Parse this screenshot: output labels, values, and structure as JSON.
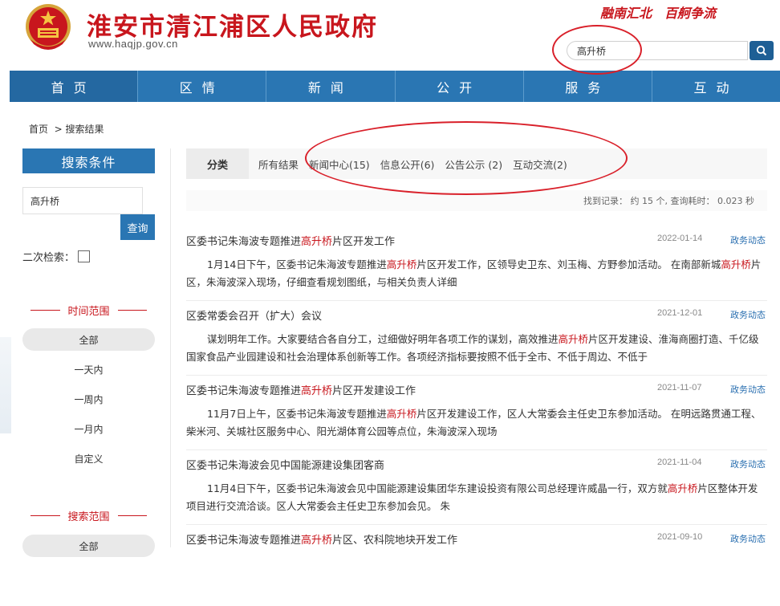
{
  "header": {
    "site_title": "淮安市清江浦区人民政府",
    "site_url": "www.haqjp.gov.cn",
    "slogan": [
      "融南汇北",
      "百舸争流"
    ]
  },
  "search": {
    "value": "高升桥"
  },
  "nav": [
    "首页",
    "区情",
    "新闻",
    "公开",
    "服务",
    "互动"
  ],
  "breadcrumb": {
    "home": "首页",
    "current": "> 搜索结果"
  },
  "left": {
    "title": "搜索条件",
    "input_value": "高升桥",
    "query_btn": "查询",
    "second_search": "二次检索：",
    "time_range": {
      "heading": "时间范围",
      "options": [
        "全部",
        "一天内",
        "一周内",
        "一月内",
        "自定义"
      ],
      "active": "全部"
    },
    "search_range": {
      "heading": "搜索范围",
      "options": [
        "全部"
      ]
    }
  },
  "tabs": {
    "category": "分类",
    "items": [
      "所有结果",
      "新闻中心(15)",
      "信息公开(6)",
      "公告公示 (2)",
      "互动交流(2)"
    ]
  },
  "stats": "找到记录： 约 15 个, 查询耗时： 0.023 秒",
  "keyword": "高升桥",
  "results": [
    {
      "title_parts": [
        "区委书记朱海波专题推进",
        "高升桥",
        "片区开发工作"
      ],
      "date": "2022-01-14",
      "category": "政务动态",
      "summary_parts": [
        "1月14日下午，区委书记朱海波专题推进",
        "高升桥",
        "片区开发工作，区领导史卫东、刘玉梅、方野参加活动。 在南部新城",
        "高升桥",
        "片区，朱海波深入现场，仔细查看规划图纸，与相关负责人详细"
      ]
    },
    {
      "title_parts": [
        "区委常委会召开（扩大）会议"
      ],
      "date": "2021-12-01",
      "category": "政务动态",
      "summary_parts": [
        "谋划明年工作。大家要结合各自分工，过细做好明年各项工作的谋划，高效推进",
        "高升桥",
        "片区开发建设、淮海商圈打造、千亿级国家食品产业园建设和社会治理体系创新等工作。各项经济指标要按照不低于全市、不低于周边、不低于"
      ]
    },
    {
      "title_parts": [
        "区委书记朱海波专题推进",
        "高升桥",
        "片区开发建设工作"
      ],
      "date": "2021-11-07",
      "category": "政务动态",
      "summary_parts": [
        "11月7日上午，区委书记朱海波专题推进",
        "高升桥",
        "片区开发建设工作，区人大常委会主任史卫东参加活动。 在明远路贯通工程、柴米河、关城社区服务中心、阳光湖体育公园等点位，朱海波深入现场"
      ]
    },
    {
      "title_parts": [
        "区委书记朱海波会见中国能源建设集团客商"
      ],
      "date": "2021-11-04",
      "category": "政务动态",
      "summary_parts": [
        "11月4日下午，区委书记朱海波会见中国能源建设集团华东建设投资有限公司总经理许威晶一行，双方就",
        "高升桥",
        "片区整体开发项目进行交流洽谈。区人大常委会主任史卫东参加会见。 朱"
      ]
    },
    {
      "title_parts": [
        "区委书记朱海波专题推进",
        "高升桥",
        "片区、农科院地块开发工作"
      ],
      "date": "2021-09-10",
      "category": "政务动态",
      "summary_parts": []
    }
  ]
}
